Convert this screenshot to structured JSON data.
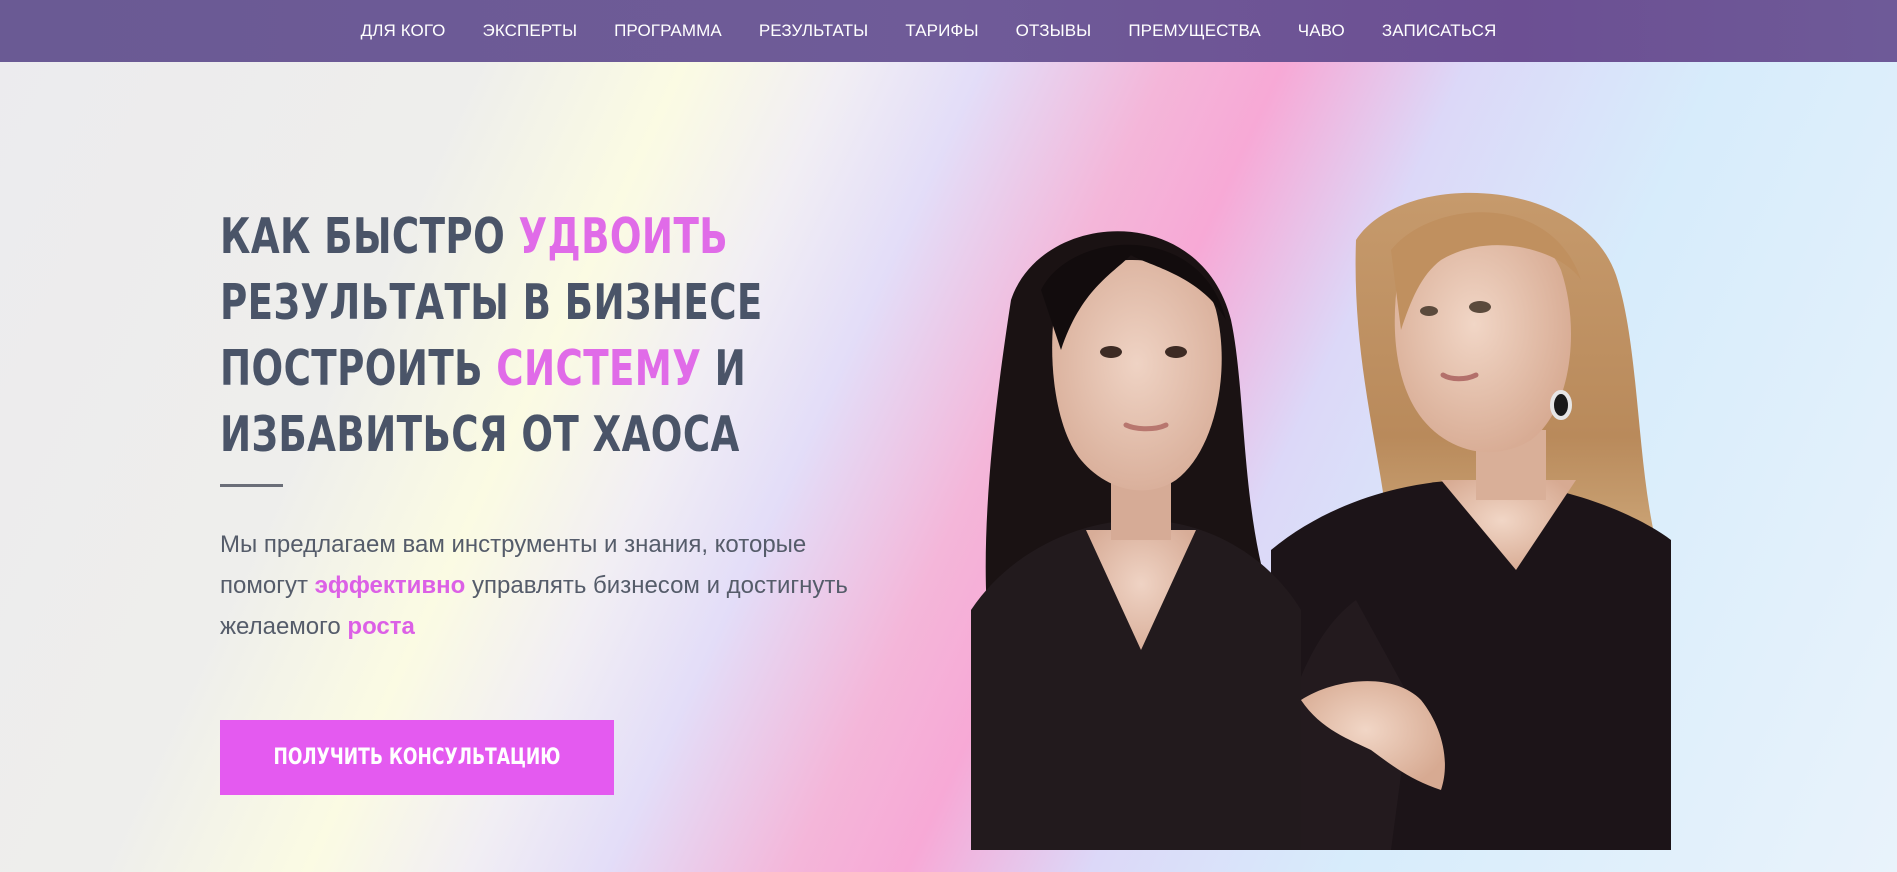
{
  "nav": {
    "items": [
      {
        "label": "ДЛЯ КОГО"
      },
      {
        "label": "ЭКСПЕРТЫ"
      },
      {
        "label": "ПРОГРАММА"
      },
      {
        "label": "РЕЗУЛЬТАТЫ"
      },
      {
        "label": "ТАРИФЫ"
      },
      {
        "label": "ОТЗЫВЫ"
      },
      {
        "label": "ПРЕМУЩЕСТВА"
      },
      {
        "label": "ЧАВО"
      },
      {
        "label": "ЗАПИСАТЬСЯ"
      }
    ]
  },
  "hero": {
    "headline": {
      "line1_a": "КАК БЫСТРО ",
      "line1_b": "УДВОИТЬ",
      "line2": "РЕЗУЛЬТАТЫ В БИЗНЕСЕ",
      "line3_a": "ПОСТРОИТЬ ",
      "line3_b": "СИСТЕМУ",
      "line3_c": " И",
      "line4": "ИЗБАВИТЬСЯ ОТ ХАОСА"
    },
    "subtitle": {
      "part1": "Мы предлагаем вам инструменты и знания, которые помогут ",
      "highlight1": "эффективно",
      "part2": " управлять бизнесом и достигнуть желаемого ",
      "highlight2": "роста"
    },
    "cta_label": "получить консультацию",
    "accent_color": "#e45af0",
    "heading_color": "#4a5468"
  },
  "photo": {
    "icon": "two-women-portrait-photo"
  }
}
